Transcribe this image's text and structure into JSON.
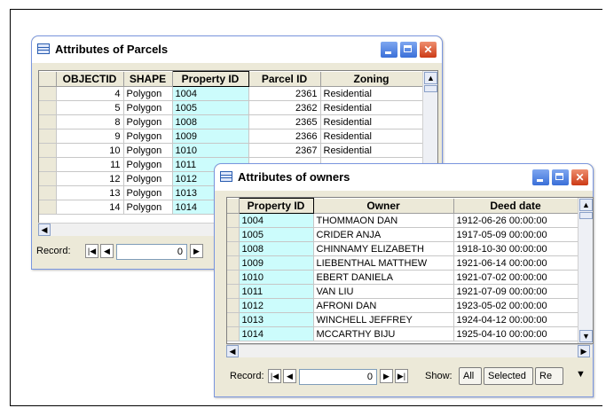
{
  "parcels": {
    "title": "Attributes of Parcels",
    "columns": [
      "OBJECTID",
      "SHAPE",
      "Property ID",
      "Parcel ID",
      "Zoning"
    ],
    "rows": [
      {
        "objectid": "4",
        "shape": "Polygon",
        "property_id": "1004",
        "parcel_id": "2361",
        "zoning": "Residential"
      },
      {
        "objectid": "5",
        "shape": "Polygon",
        "property_id": "1005",
        "parcel_id": "2362",
        "zoning": "Residential"
      },
      {
        "objectid": "8",
        "shape": "Polygon",
        "property_id": "1008",
        "parcel_id": "2365",
        "zoning": "Residential"
      },
      {
        "objectid": "9",
        "shape": "Polygon",
        "property_id": "1009",
        "parcel_id": "2366",
        "zoning": "Residential"
      },
      {
        "objectid": "10",
        "shape": "Polygon",
        "property_id": "1010",
        "parcel_id": "2367",
        "zoning": "Residential"
      },
      {
        "objectid": "11",
        "shape": "Polygon",
        "property_id": "1011",
        "parcel_id": "",
        "zoning": ""
      },
      {
        "objectid": "12",
        "shape": "Polygon",
        "property_id": "1012",
        "parcel_id": "",
        "zoning": ""
      },
      {
        "objectid": "13",
        "shape": "Polygon",
        "property_id": "1013",
        "parcel_id": "",
        "zoning": ""
      },
      {
        "objectid": "14",
        "shape": "Polygon",
        "property_id": "1014",
        "parcel_id": "",
        "zoning": ""
      }
    ],
    "record_label": "Record:",
    "record_value": "0"
  },
  "owners": {
    "title": "Attributes of owners",
    "columns": [
      "Property ID",
      "Owner",
      "Deed date"
    ],
    "rows": [
      {
        "property_id": "1004",
        "owner": "THOMMAON DAN",
        "deed_date": "1912-06-26 00:00:00"
      },
      {
        "property_id": "1005",
        "owner": "CRIDER ANJA",
        "deed_date": "1917-05-09 00:00:00"
      },
      {
        "property_id": "1008",
        "owner": "CHINNAMY ELIZABETH",
        "deed_date": "1918-10-30 00:00:00"
      },
      {
        "property_id": "1009",
        "owner": "LIEBENTHAL MATTHEW",
        "deed_date": "1921-06-14 00:00:00"
      },
      {
        "property_id": "1010",
        "owner": "EBERT DANIELA",
        "deed_date": "1921-07-02 00:00:00"
      },
      {
        "property_id": "1011",
        "owner": "VAN LIU",
        "deed_date": "1921-07-09 00:00:00"
      },
      {
        "property_id": "1012",
        "owner": "AFRONI DAN",
        "deed_date": "1923-05-02 00:00:00"
      },
      {
        "property_id": "1013",
        "owner": "WINCHELL JEFFREY",
        "deed_date": "1924-04-12 00:00:00"
      },
      {
        "property_id": "1014",
        "owner": "MCCARTHY BIJU",
        "deed_date": "1925-04-10 00:00:00"
      }
    ],
    "record_label": "Record:",
    "record_value": "0",
    "show_label": "Show:",
    "show_all": "All",
    "show_selected": "Selected",
    "records_button": "Re"
  },
  "colors": {
    "highlight": "#ccfcfc",
    "title_accent": "#3a6fd8",
    "close_button": "#cc3a16"
  }
}
